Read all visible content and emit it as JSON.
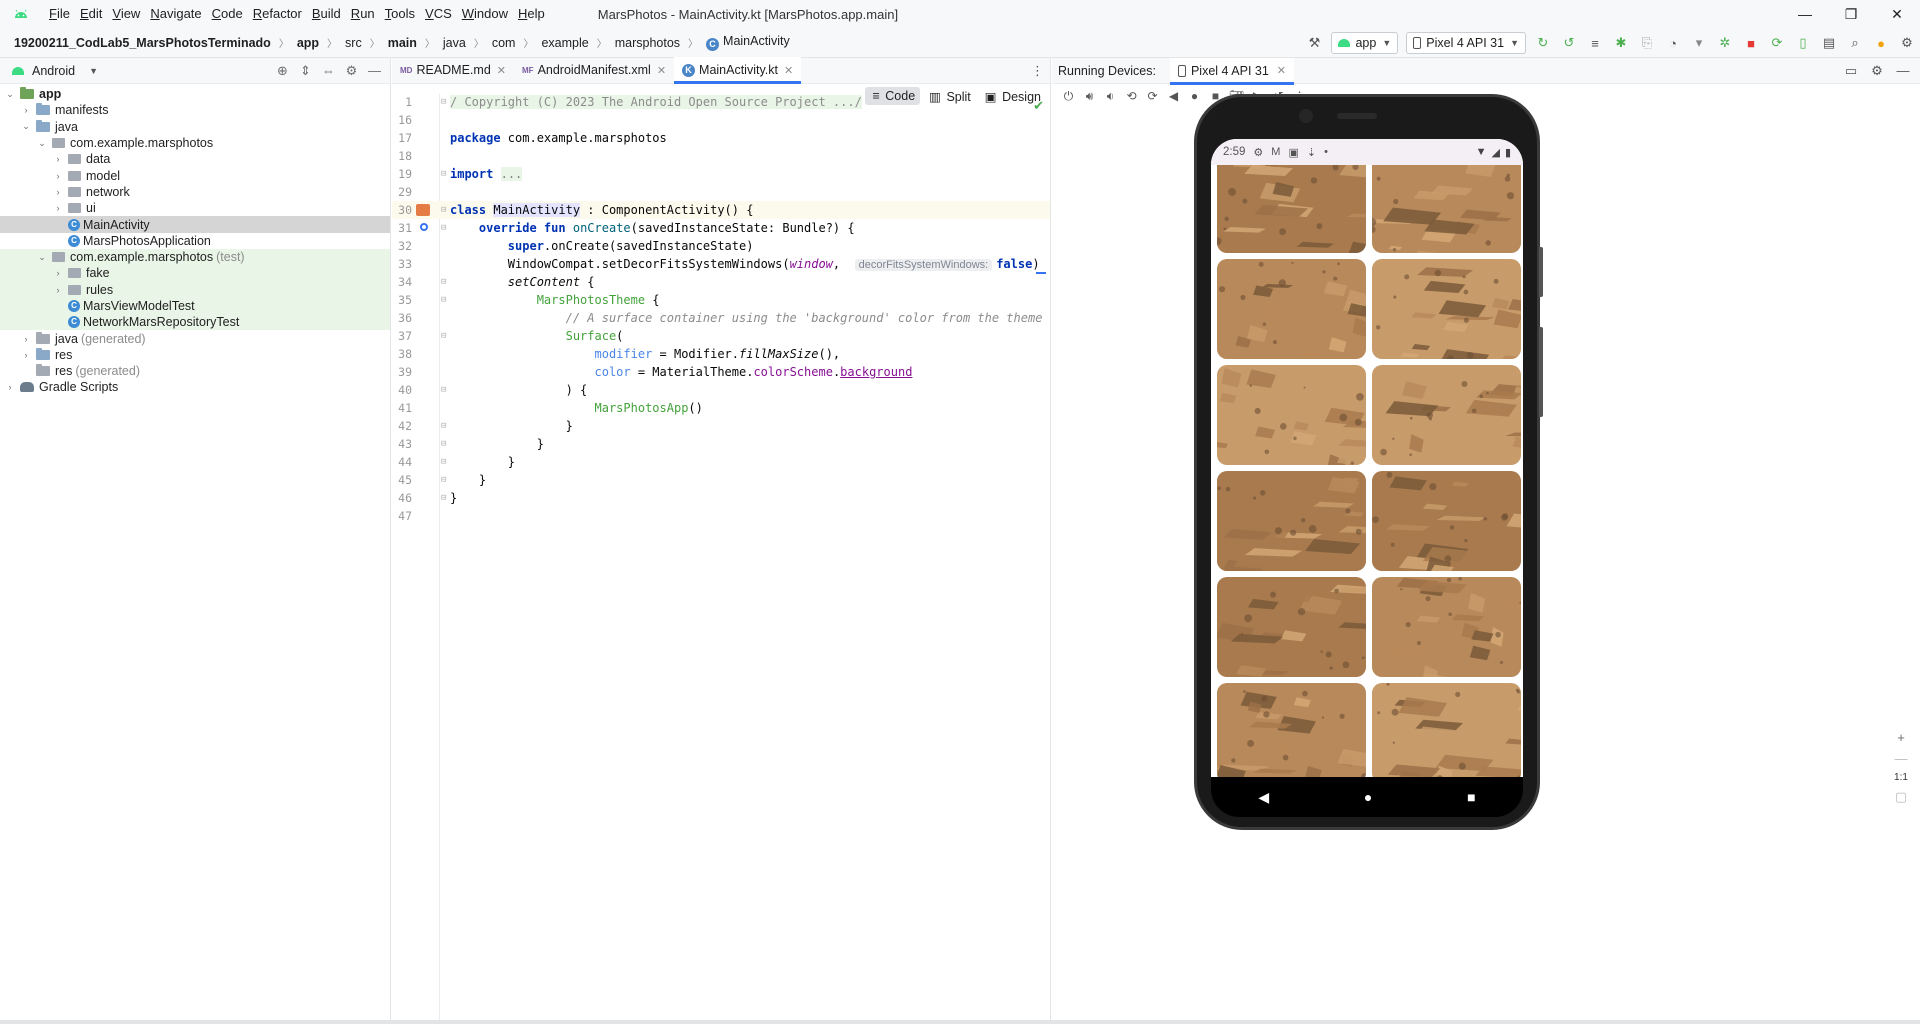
{
  "window": {
    "menu": [
      "File",
      "Edit",
      "View",
      "Navigate",
      "Code",
      "Refactor",
      "Build",
      "Run",
      "Tools",
      "VCS",
      "Window",
      "Help"
    ],
    "title": "MarsPhotos - MainActivity.kt [MarsPhotos.app.main]"
  },
  "breadcrumb": [
    "19200211_CodLab5_MarsPhotosTerminado",
    "app",
    "src",
    "main",
    "java",
    "com",
    "example",
    "marsphotos",
    "MainActivity"
  ],
  "toolbar": {
    "run_config": "app",
    "device": "Pixel 4 API 31"
  },
  "project": {
    "view": "Android",
    "tree": [
      {
        "label": "app",
        "level": 0,
        "type": "module",
        "expanded": true
      },
      {
        "label": "manifests",
        "level": 1,
        "type": "folder",
        "expanded": false
      },
      {
        "label": "java",
        "level": 1,
        "type": "folder",
        "expanded": true
      },
      {
        "label": "com.example.marsphotos",
        "level": 2,
        "type": "package",
        "expanded": true
      },
      {
        "label": "data",
        "level": 3,
        "type": "package",
        "expanded": false
      },
      {
        "label": "model",
        "level": 3,
        "type": "package",
        "expanded": false
      },
      {
        "label": "network",
        "level": 3,
        "type": "package",
        "expanded": false
      },
      {
        "label": "ui",
        "level": 3,
        "type": "package",
        "expanded": false
      },
      {
        "label": "MainActivity",
        "level": 3,
        "type": "class",
        "selected": true
      },
      {
        "label": "MarsPhotosApplication",
        "level": 3,
        "type": "class"
      },
      {
        "label": "com.example.marsphotos",
        "suffix": "(test)",
        "level": 2,
        "type": "package",
        "expanded": true,
        "test": true
      },
      {
        "label": "fake",
        "level": 3,
        "type": "package",
        "expanded": false,
        "test": true
      },
      {
        "label": "rules",
        "level": 3,
        "type": "package",
        "expanded": false,
        "test": true
      },
      {
        "label": "MarsViewModelTest",
        "level": 3,
        "type": "class",
        "test": true
      },
      {
        "label": "NetworkMarsRepositoryTest",
        "level": 3,
        "type": "class",
        "test": true
      },
      {
        "label": "java",
        "suffix": "(generated)",
        "level": 1,
        "type": "folder-gray",
        "expanded": false
      },
      {
        "label": "res",
        "level": 1,
        "type": "folder",
        "expanded": false
      },
      {
        "label": "res",
        "suffix": "(generated)",
        "level": 1,
        "type": "folder-gray",
        "leaf": true
      },
      {
        "label": "Gradle Scripts",
        "level": 0,
        "type": "gradle",
        "expanded": false
      }
    ]
  },
  "editor": {
    "tabs": [
      {
        "label": "README.md",
        "icon": "MD",
        "active": false
      },
      {
        "label": "AndroidManifest.xml",
        "icon": "MF",
        "active": false
      },
      {
        "label": "MainActivity.kt",
        "icon": "K",
        "active": true
      }
    ],
    "view_modes": [
      "Code",
      "Split",
      "Design"
    ],
    "active_view_mode": "Code",
    "lines": [
      {
        "n": "1",
        "html": "<span class=\"cmt-block\">/ Copyright (C) 2023 The Android Open Source Project .../</span>"
      },
      {
        "n": "16",
        "html": ""
      },
      {
        "n": "17",
        "html": "<span class=\"kw\">package</span> com.example.marsphotos"
      },
      {
        "n": "18",
        "html": ""
      },
      {
        "n": "19",
        "html": "<span class=\"kw\">import</span> <span class=\"folded\">...</span>"
      },
      {
        "n": "29",
        "html": ""
      },
      {
        "n": "30",
        "html": "<span class=\"kw\">class</span> <span style=\"background:#e4e4ff\">MainActivity</span> : ComponentActivity() {",
        "current": true,
        "gicon": "red"
      },
      {
        "n": "31",
        "html": "    <span class=\"kw\">override fun</span> <span class=\"fn\">onCreate</span>(savedInstanceState: Bundle?) {",
        "gicon": "blue"
      },
      {
        "n": "32",
        "html": "        <span class=\"kw\">super</span>.onCreate(savedInstanceState)"
      },
      {
        "n": "33",
        "html": "        WindowCompat.setDecorFitsSystemWindows(<span class=\"prm\">window</span>,  <span class=\"hint\">decorFitsSystemWindows:</span><span class=\"kw\">false</span>)"
      },
      {
        "n": "34",
        "html": "        <span class=\"italic\">setContent</span> {"
      },
      {
        "n": "35",
        "html": "            <span class=\"compose\">MarsPhotosTheme</span> {"
      },
      {
        "n": "36",
        "html": "                <span class=\"comment\">// A surface container using the 'background' color from the theme</span>"
      },
      {
        "n": "37",
        "html": "                <span class=\"compose\">Surface</span>("
      },
      {
        "n": "38",
        "html": "                    <span class=\"named\">modifier</span> = Modifier.<span class=\"italic\">fillMaxSize</span>(),"
      },
      {
        "n": "39",
        "html": "                    <span class=\"named\">color</span> = MaterialTheme.<span class=\"prop\">colorScheme</span>.<span class=\"prop ul\">background</span>"
      },
      {
        "n": "40",
        "html": "                ) {"
      },
      {
        "n": "41",
        "html": "                    <span class=\"compose\">MarsPhotosApp</span>()"
      },
      {
        "n": "42",
        "html": "                }"
      },
      {
        "n": "43",
        "html": "            }"
      },
      {
        "n": "44",
        "html": "        }"
      },
      {
        "n": "45",
        "html": "    }"
      },
      {
        "n": "46",
        "html": "}"
      },
      {
        "n": "47",
        "html": ""
      }
    ]
  },
  "devices": {
    "title": "Running Devices:",
    "tab": "Pixel 4 API 31",
    "phone": {
      "time": "2:59",
      "zoom_label": "1:1"
    }
  },
  "colors": {
    "accent": "#3574f0",
    "mars_light": "#c89b6a",
    "mars_dark": "#7a5a3a"
  }
}
